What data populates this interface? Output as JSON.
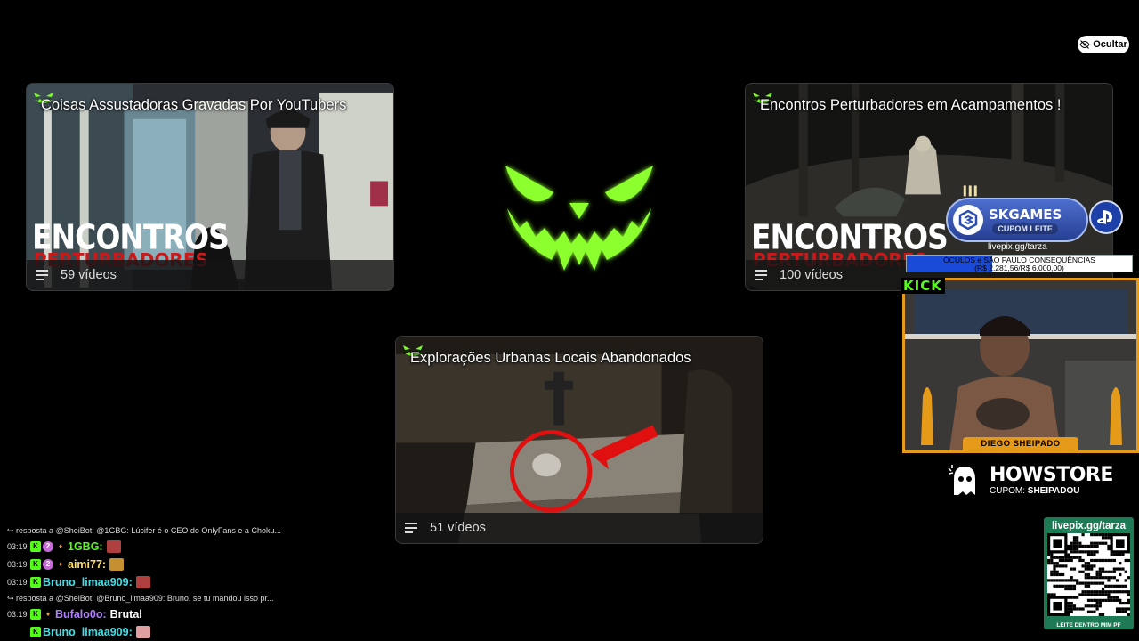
{
  "hide_button": {
    "label": "Ocultar",
    "icon": "eye-off-icon"
  },
  "playlists": [
    {
      "title": "Coisas Assustadoras Gravadas Por YouTubers",
      "count": "59 vídeos",
      "overlay_line1": "ENCONTROS",
      "overlay_line2": "PERTURBADORES"
    },
    {
      "title": "Encontros Perturbadores em Acampamentos !",
      "count": "100 vídeos",
      "overlay_line1": "ENCONTROS",
      "overlay_line2": "PERTURBADORES"
    },
    {
      "title": "Explorações Urbanas Locais Abandonados",
      "count": "51 vídeos"
    }
  ],
  "colors": {
    "accent_green": "#7cff2a",
    "kick_green": "#53fc18",
    "cam_border": "#e59a1a",
    "qr_green": "#1e7a55"
  },
  "sponsor": {
    "name": "SKGAMES",
    "coupon": "CUPOM LEITE",
    "link": "livepix.gg/tarza"
  },
  "goal": {
    "line1": "ÓCULOS e SÃO PAULO CONSEQUÊNCIAS",
    "line2": "(R$ 2.281,56/R$ 6.000,00)",
    "current": 2281.56,
    "target": 6000
  },
  "webcam": {
    "platform_tag": "KICK",
    "name": "DIEGO SHEIPADO"
  },
  "howstore": {
    "title": "HOWSTORE",
    "coupon_label": "CUPOM:",
    "coupon_code": "SHEIPADOU"
  },
  "qr": {
    "top": "livepix.gg/tarza",
    "bottom": "LEITE DENTRO MIM PF"
  },
  "chat": [
    {
      "type": "reply",
      "text": "↪ resposta a @SheiBot: @1GBG: Lúcifer é o CEO do OnlyFans e a Choku..."
    },
    {
      "type": "msg",
      "time": "03:19",
      "badges": [
        "kick",
        "sub",
        "fire"
      ],
      "user": "1GBG",
      "color": "#53fc18",
      "text": "",
      "emote": "#b04040"
    },
    {
      "type": "msg",
      "time": "03:19",
      "badges": [
        "kick",
        "sub",
        "fire"
      ],
      "user": "aimi77",
      "color": "#ffe060",
      "text": "",
      "emote": "#c49030"
    },
    {
      "type": "msg",
      "time": "03:19",
      "badges": [
        "kick"
      ],
      "user": "Bruno_limaa909",
      "color": "#40e0e8",
      "text": "",
      "emote": "#b04040"
    },
    {
      "type": "reply",
      "text": "↪ resposta a @SheiBot: @Bruno_limaa909: Bruno, se tu mandou isso pr..."
    },
    {
      "type": "msg",
      "time": "03:19",
      "badges": [
        "kick",
        "fire"
      ],
      "user": "Bufalo0o",
      "color": "#b080ff",
      "text": "Brutal",
      "emote": ""
    },
    {
      "type": "msg",
      "time": "",
      "badges": [
        "kick"
      ],
      "user": "Bruno_limaa909",
      "color": "#40e0e8",
      "text": "",
      "emote": "#e0a0a0"
    }
  ]
}
